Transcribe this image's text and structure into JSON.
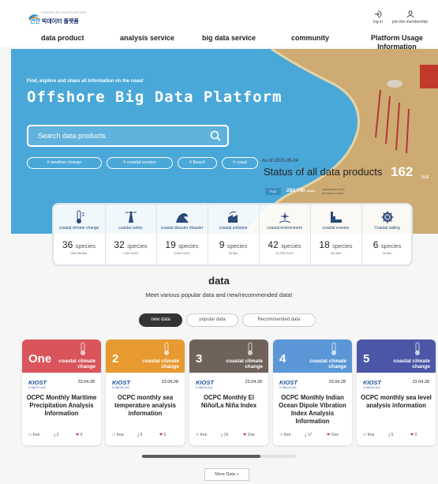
{
  "header": {
    "logo_small": "COASTAL BIG DATA PLATFORM",
    "logo_korean_prefix": "연안",
    "logo_korean_main": "빅데이터 플랫폼",
    "login_label": "log in",
    "join_label": "join the membership"
  },
  "nav": {
    "items": [
      "data product",
      "analysis service",
      "big data service",
      "community",
      "Platform Usage Information"
    ]
  },
  "hero": {
    "small_text": "Find, explore and share all information on the coast",
    "title": "Offshore Big Data Platform",
    "search_placeholder": "Search data products.",
    "tags": [
      "# weather change",
      "# coastal erosion",
      "# Beach",
      "# coast"
    ],
    "status_date": "As of 2023-05-04",
    "status_title": "Status of all data products",
    "status_count": "162",
    "status_unit": "bell",
    "file_badge": "FILE",
    "file_count": "282,740",
    "file_count_unit": "cases",
    "file_note": "compared to the previous month",
    "colors": {
      "sea": "#4aa8d8",
      "sand": "#cdab72"
    }
  },
  "stats": [
    {
      "icon": "thermometer-icon",
      "label": "coastal climate change",
      "value": "36",
      "unit": "species",
      "files": "266,236 files"
    },
    {
      "icon": "lighthouse-icon",
      "label": "coastal safety",
      "value": "32",
      "unit": "species",
      "files": "1,944 FILES"
    },
    {
      "icon": "wave-icon",
      "label": "coastal disaster disaster",
      "value": "19",
      "unit": "species",
      "files": "3,244 FILES"
    },
    {
      "icon": "factory-icon",
      "label": "coastal pollution",
      "value": "9",
      "unit": "species",
      "files": "50 files"
    },
    {
      "icon": "sparkle-icon",
      "label": "coastal environment",
      "value": "42",
      "unit": "species",
      "files": "10,793 FILES"
    },
    {
      "icon": "erosion-icon",
      "label": "coastal erosion",
      "value": "18",
      "unit": "species",
      "files": "453 files"
    },
    {
      "icon": "ship-wheel-icon",
      "label": "Coastal sailing",
      "value": "6",
      "unit": "species",
      "files": "30 files"
    }
  ],
  "section": {
    "title": "data",
    "subtitle": "Meet various popular data and new/recommended data!",
    "tabs": [
      "new data",
      "popular data",
      "Recommended data"
    ]
  },
  "cards": [
    {
      "num": "One",
      "category": "coastal climate change",
      "color": "#d9545b",
      "org": "KIOST",
      "org_sub": "한국해양과학기술원",
      "date": "23.04.28",
      "title": "OCPC Monthly Maritime Precipitation Analysis Information",
      "license": "free",
      "downloads": "2",
      "likes": "0"
    },
    {
      "num": "2",
      "category": "coastal climate change",
      "color": "#e79a2f",
      "org": "KIOST",
      "org_sub": "한국해양과학기술원",
      "date": "23.04.28",
      "title": "OCPC monthly sea temperature analysis information",
      "license": "free",
      "downloads": "5",
      "likes": "0"
    },
    {
      "num": "3",
      "category": "coastal climate change",
      "color": "#6f625a",
      "org": "KIOST",
      "org_sub": "한국해양과학기술원",
      "date": "23.04.28",
      "title": "OCPC Monthly El Niño/La Niña Index",
      "license": "free",
      "downloads": "19",
      "likes": "One"
    },
    {
      "num": "4",
      "category": "coastal climate change",
      "color": "#5b97d6",
      "org": "KIOST",
      "org_sub": "한국해양과학기술원",
      "date": "23.04.28",
      "title": "OCPC Monthly Indian Ocean Dipole Vibration Index Analysis Information",
      "license": "free",
      "downloads": "17",
      "likes": "One"
    },
    {
      "num": "5",
      "category": "coastal climate change",
      "color": "#4b57a6",
      "org": "KIOST",
      "org_sub": "한국해양과학기술원",
      "date": "23.04.28",
      "title": "OCPC monthly sea level analysis information",
      "license": "free",
      "downloads": "5",
      "likes": "0"
    }
  ],
  "more_label": "More Data +",
  "scroll_progress": 0.77
}
